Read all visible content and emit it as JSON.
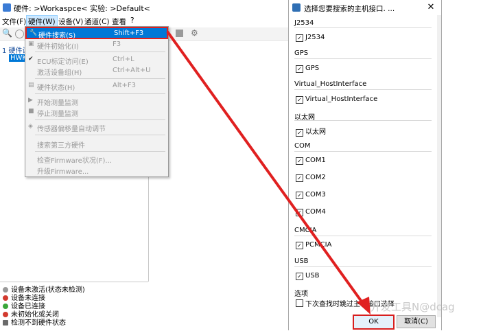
{
  "main_window": {
    "title": "硬件: >Workaspce<  实验: >Default<",
    "menus": [
      "文件(F)",
      "硬件(W)",
      "设备(V)",
      "通道(C)",
      "查看",
      "?"
    ],
    "tree": {
      "root": "1 硬件设",
      "node": "HWK"
    },
    "legend": [
      {
        "label": "设备未激活(状态未检测)",
        "color": "#9a9a9a"
      },
      {
        "label": "设备未连接",
        "color": "#d23a2e"
      },
      {
        "label": "设备已连接",
        "color": "#3aa63a"
      },
      {
        "label": "未初始化或关闭",
        "color": "#d23a2e"
      },
      {
        "label": "检测不到硬件状态",
        "color": "#6a6a6a"
      }
    ]
  },
  "hardware_menu": {
    "items": [
      {
        "label": "硬件搜索(S)",
        "shortcut": "Shift+F3"
      },
      {
        "label": "硬件初始化(I)",
        "shortcut": "F3"
      },
      {
        "label": "ECU标定访问(E)",
        "shortcut": "Ctrl+L"
      },
      {
        "label": "激活设备组(H)",
        "shortcut": "Ctrl+Alt+U"
      },
      {
        "label": "硬件状态(H)",
        "shortcut": "Alt+F3"
      },
      {
        "label": "开始测量监测",
        "shortcut": ""
      },
      {
        "label": "停止测量监测",
        "shortcut": ""
      },
      {
        "label": "传感器偏移量自动调节",
        "shortcut": ""
      },
      {
        "label": "搜索第三方硬件",
        "shortcut": ""
      },
      {
        "label": "检查Firmware状况(F)...",
        "shortcut": ""
      },
      {
        "label": "升级Firmware...",
        "shortcut": ""
      }
    ]
  },
  "dialog": {
    "title": "选择您要搜索的主机接口.  ...",
    "close": "✕",
    "groups": [
      {
        "name": "J2534",
        "items": [
          "J2534"
        ]
      },
      {
        "name": "GPS",
        "items": [
          "GPS"
        ]
      },
      {
        "name": "Virtual_HostInterface",
        "items": [
          "Virtual_HostInterface"
        ]
      },
      {
        "name": "以太网",
        "items": [
          "以太网"
        ]
      },
      {
        "name": "COM",
        "items": [
          "COM1",
          "COM2",
          "COM3",
          "COM4"
        ]
      },
      {
        "name": "CMCIA",
        "items": [
          "PCMCIA"
        ]
      },
      {
        "name": "USB",
        "items": [
          "USB"
        ]
      },
      {
        "name": "选项",
        "items": []
      }
    ],
    "option_text": "下次查找时跳过主机接口选择",
    "ok": "OK",
    "cancel": "取消(C)"
  },
  "watermark": "开发工具N@dcag",
  "colors": {
    "highlight_red": "#e02020",
    "menu_blue": "#0078d7"
  }
}
